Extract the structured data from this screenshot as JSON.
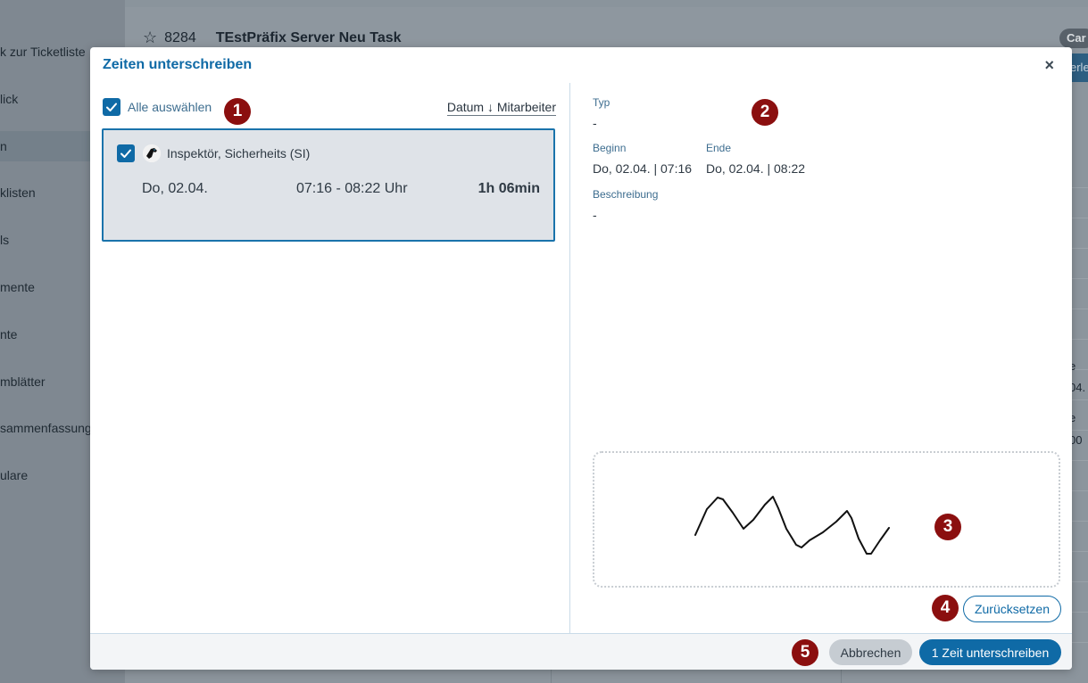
{
  "background": {
    "sidebar_items": [
      "k zur Ticketliste",
      "lick",
      "n",
      "klisten",
      "ls",
      "mente",
      "nte",
      "mblätter",
      "sammenfassung",
      "ulare"
    ],
    "ticket_number": "8284",
    "ticket_title": "TEstPräfix  Server Neu Task",
    "pill_text": "Car",
    "blue_button_text": "erle",
    "side_texts": [
      "e",
      "04.",
      "e",
      "00"
    ]
  },
  "modal": {
    "title": "Zeiten unterschreiben",
    "close_label": "×",
    "select_all_label": "Alle auswählen",
    "sort_label": "Datum ↓ Mitarbeiter",
    "entries": [
      {
        "name": "Inspektör, Sicherheits (SI)",
        "date": "Do, 02.04.",
        "time_range": "07:16 - 08:22 Uhr",
        "duration": "1h 06min",
        "checked": true
      }
    ],
    "details": {
      "type_label": "Typ",
      "type_value": "-",
      "begin_label": "Beginn",
      "begin_value": "Do, 02.04. | 07:16",
      "end_label": "Ende",
      "end_value": "Do, 02.04. | 08:22",
      "description_label": "Beschreibung",
      "description_value": "-"
    },
    "reset_label": "Zurücksetzen",
    "cancel_label": "Abbrechen",
    "submit_label": "1 Zeit unterschreiben"
  },
  "markers": [
    "1",
    "2",
    "3",
    "4",
    "5"
  ],
  "colors": {
    "accent": "#0f6aa6",
    "marker": "#8b0f0f"
  }
}
